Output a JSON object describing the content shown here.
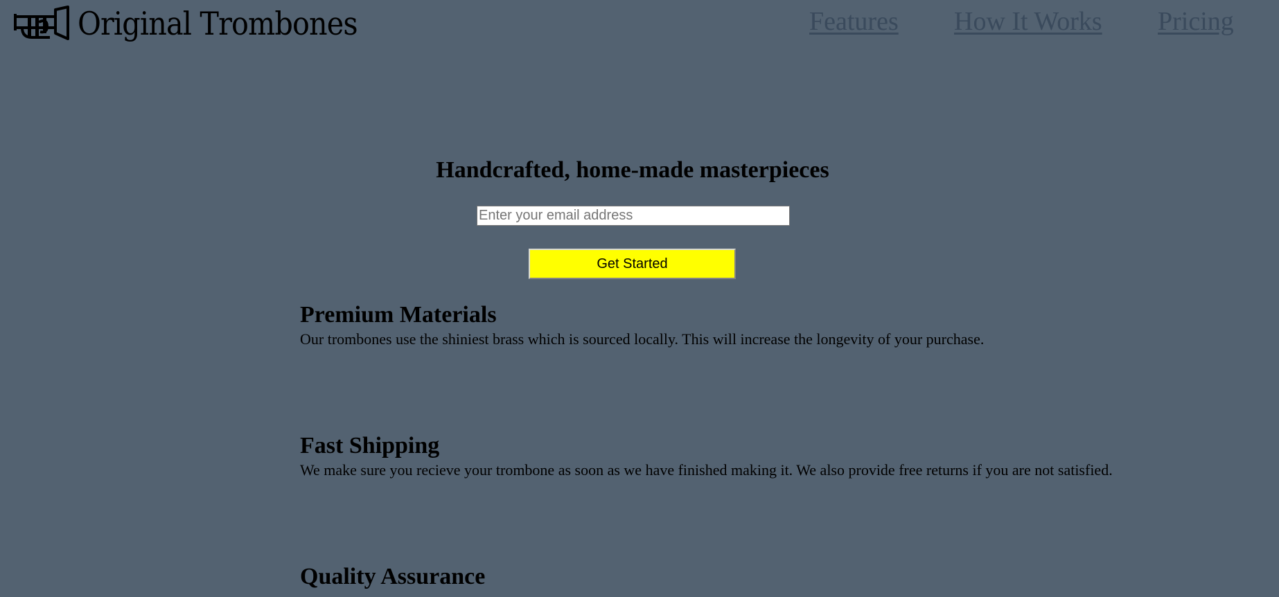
{
  "header": {
    "logo_text": "Original Trombones",
    "logo_icon": "trumpet-icon",
    "nav": [
      {
        "label": "Features"
      },
      {
        "label": "How It Works"
      },
      {
        "label": "Pricing"
      }
    ]
  },
  "hero": {
    "title": "Handcrafted, home-made masterpieces",
    "email_placeholder": "Enter your email address",
    "cta_label": "Get Started"
  },
  "features": [
    {
      "title": "Premium Materials",
      "text": "Our trombones use the shiniest brass which is sourced locally. This will increase the longevity of your purchase."
    },
    {
      "title": "Fast Shipping",
      "text": "We make sure you recieve your trombone as soon as we have finished making it. We also provide free returns if you are not satisfied."
    },
    {
      "title": "Quality Assurance",
      "text": ""
    }
  ],
  "colors": {
    "background": "#536271",
    "nav_link": "#3a4a5c",
    "cta_button": "#ffff00"
  }
}
